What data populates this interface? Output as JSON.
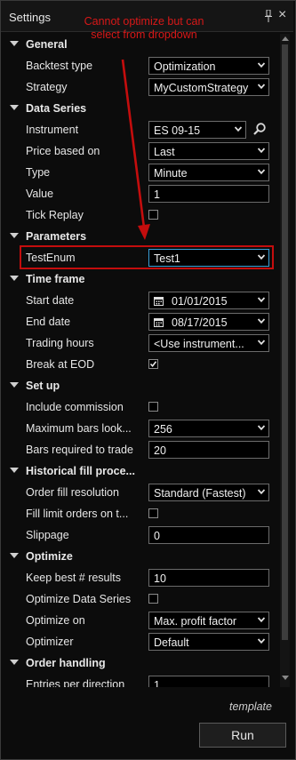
{
  "window": {
    "title": "Settings"
  },
  "annotation": {
    "line1": "Cannot optimize but can",
    "line2": "select from dropdown"
  },
  "sections": {
    "general": "General",
    "data_series": "Data Series",
    "parameters": "Parameters",
    "time_frame": "Time frame",
    "set_up": "Set up",
    "historical_fill": "Historical fill proce...",
    "optimize": "Optimize",
    "order_handling": "Order handling"
  },
  "props": {
    "backtest_type": {
      "label": "Backtest type",
      "value": "Optimization"
    },
    "strategy": {
      "label": "Strategy",
      "value": "MyCustomStrategy"
    },
    "instrument": {
      "label": "Instrument",
      "value": "ES 09-15"
    },
    "price_based_on": {
      "label": "Price based on",
      "value": "Last"
    },
    "type": {
      "label": "Type",
      "value": "Minute"
    },
    "value": {
      "label": "Value",
      "value": "1"
    },
    "tick_replay": {
      "label": "Tick Replay",
      "checked": false
    },
    "test_enum": {
      "label": "TestEnum",
      "value": "Test1"
    },
    "start_date": {
      "label": "Start date",
      "value": "01/01/2015"
    },
    "end_date": {
      "label": "End date",
      "value": "08/17/2015"
    },
    "trading_hours": {
      "label": "Trading hours",
      "value": "<Use instrument..."
    },
    "break_at_eod": {
      "label": "Break at EOD",
      "checked": true
    },
    "include_commission": {
      "label": "Include commission",
      "checked": false
    },
    "max_bars_lookback": {
      "label": "Maximum bars look...",
      "value": "256"
    },
    "bars_required": {
      "label": "Bars required to trade",
      "value": "20"
    },
    "order_fill_resolution": {
      "label": "Order fill resolution",
      "value": "Standard (Fastest)"
    },
    "fill_limit_orders": {
      "label": "Fill limit orders on t...",
      "checked": false
    },
    "slippage": {
      "label": "Slippage",
      "value": "0"
    },
    "keep_best_results": {
      "label": "Keep best # results",
      "value": "10"
    },
    "optimize_data_series": {
      "label": "Optimize Data Series",
      "checked": false
    },
    "optimize_on": {
      "label": "Optimize on",
      "value": "Max. profit factor"
    },
    "optimizer": {
      "label": "Optimizer",
      "value": "Default"
    },
    "entries_per_direction": {
      "label": "Entries per direction",
      "value": "1"
    }
  },
  "footer": {
    "template_link": "template",
    "run_button": "Run"
  },
  "colors": {
    "accent_red": "#c40d0d",
    "focus_blue": "#3aa0d8"
  }
}
